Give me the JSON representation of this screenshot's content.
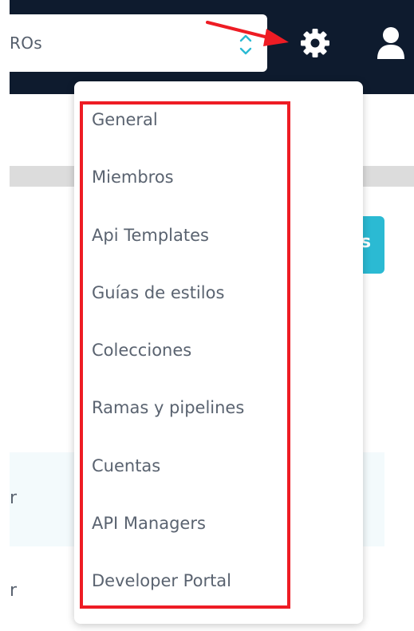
{
  "header": {
    "org_select_value": "ROs",
    "settings_icon": "gear-icon",
    "profile_icon": "user-icon"
  },
  "colors": {
    "navy": "#0e1b2e",
    "teal": "#2bbad3",
    "highlight_red": "#ee1c24",
    "menu_text": "#5a6370"
  },
  "page": {
    "teal_button_label": "s",
    "row_fragments": [
      "r",
      "r"
    ]
  },
  "settings_menu": {
    "items": [
      "General",
      "Miembros",
      "Api Templates",
      "Guías de estilos",
      "Colecciones",
      "Ramas y pipelines",
      "Cuentas",
      "API Managers",
      "Developer Portal"
    ]
  }
}
